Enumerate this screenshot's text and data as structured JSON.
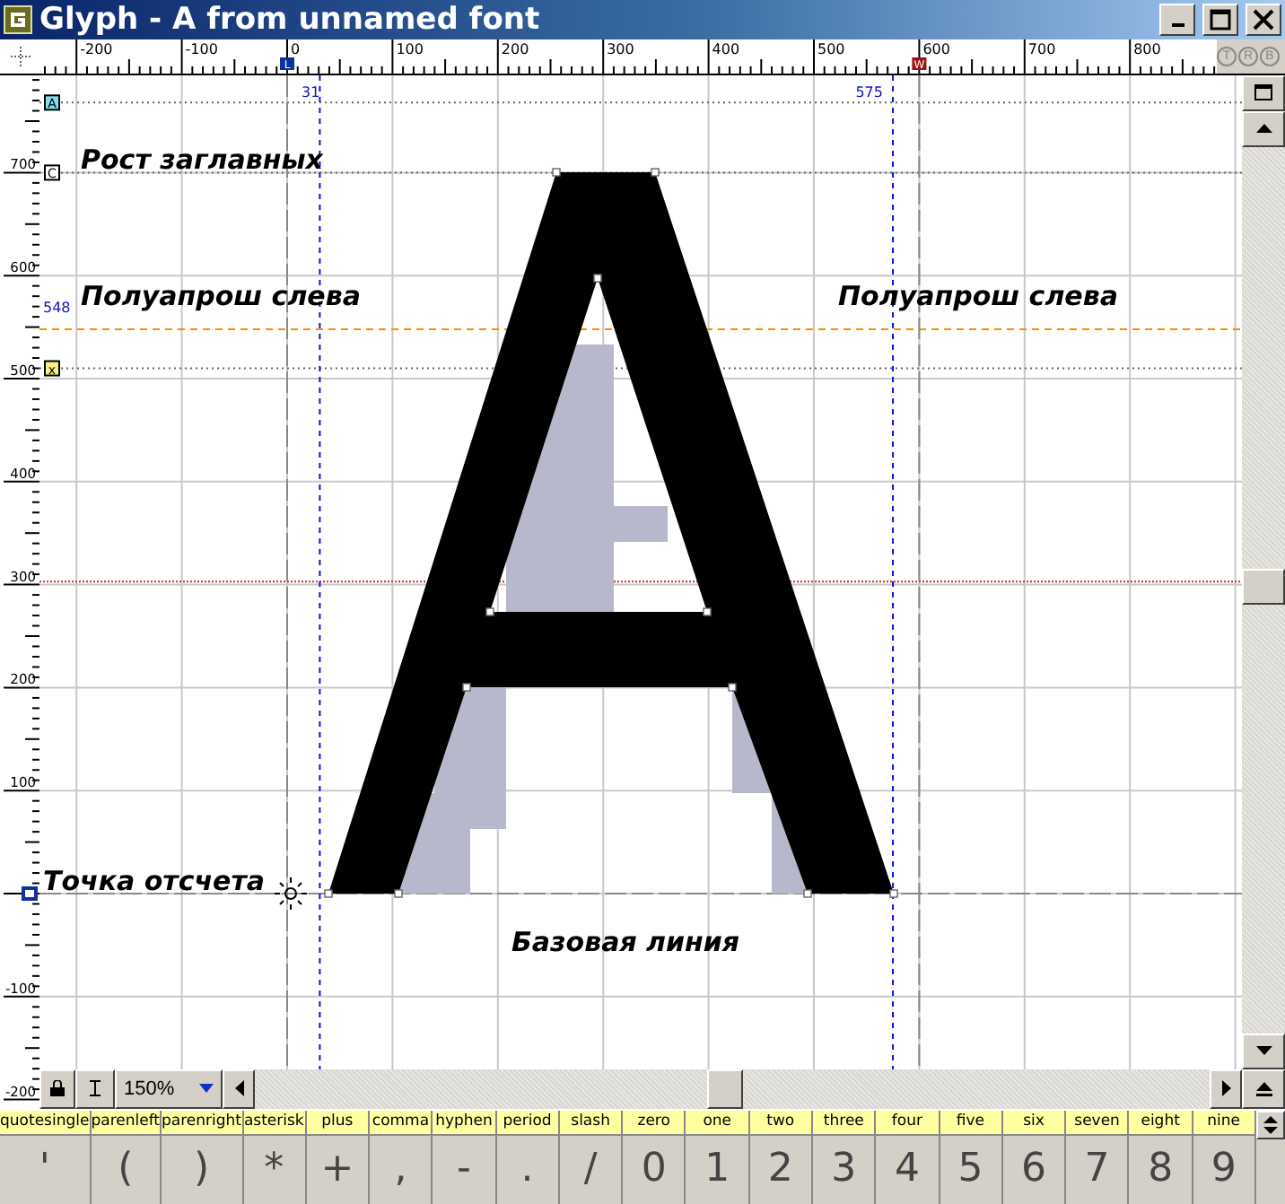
{
  "window": {
    "title": "Glyph - A from unnamed font"
  },
  "ruler_top": {
    "labels": [
      "-200",
      "-100",
      "0",
      "100",
      "200",
      "300",
      "400",
      "500",
      "600",
      "700",
      "800"
    ],
    "markers": [
      {
        "letter": "L",
        "kind": "left"
      },
      {
        "letter": "W",
        "kind": "width"
      }
    ],
    "corner_buttons": [
      "T",
      "R",
      "B"
    ]
  },
  "ruler_left": {
    "labels": [
      "700",
      "600",
      "500",
      "400",
      "300",
      "200",
      "100",
      "-100",
      "-200"
    ],
    "markers": [
      {
        "letter": "A",
        "kind": "ascender"
      },
      {
        "letter": "C",
        "kind": "cap"
      },
      {
        "letter": "x",
        "kind": "xheight"
      }
    ]
  },
  "canvas": {
    "readouts": [
      {
        "text": "31",
        "kind": "left"
      },
      {
        "text": "575",
        "kind": "right"
      },
      {
        "text": "548",
        "kind": "guide"
      }
    ],
    "annotations": [
      {
        "text": "Рост заглавных"
      },
      {
        "text": "Полуапрош слева"
      },
      {
        "text": "Полуапрош слева"
      },
      {
        "text": "Точка отсчета"
      },
      {
        "text": "Базовая линия"
      }
    ]
  },
  "toolbar": {
    "zoom": "150%"
  },
  "glyphs": [
    {
      "name": "quotesingle",
      "char": "'"
    },
    {
      "name": "parenleft",
      "char": "("
    },
    {
      "name": "parenright",
      "char": ")"
    },
    {
      "name": "asterisk",
      "char": "*"
    },
    {
      "name": "plus",
      "char": "+"
    },
    {
      "name": "comma",
      "char": ","
    },
    {
      "name": "hyphen",
      "char": "-"
    },
    {
      "name": "period",
      "char": "."
    },
    {
      "name": "slash",
      "char": "/"
    },
    {
      "name": "zero",
      "char": "0"
    },
    {
      "name": "one",
      "char": "1"
    },
    {
      "name": "two",
      "char": "2"
    },
    {
      "name": "three",
      "char": "3"
    },
    {
      "name": "four",
      "char": "4"
    },
    {
      "name": "five",
      "char": "5"
    },
    {
      "name": "six",
      "char": "6"
    },
    {
      "name": "seven",
      "char": "7"
    },
    {
      "name": "eight",
      "char": "8"
    },
    {
      "name": "nine",
      "char": "9"
    }
  ]
}
